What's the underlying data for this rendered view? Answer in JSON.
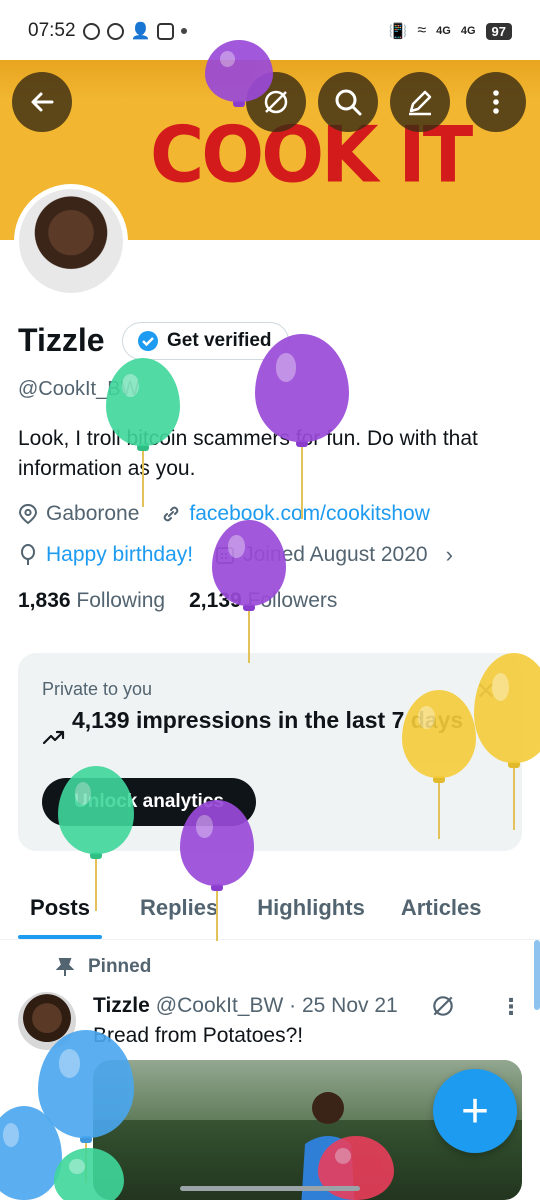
{
  "status": {
    "time": "07:52",
    "net1": "4G",
    "net2": "4G",
    "battery": "97"
  },
  "banner": {
    "logo_text": "COOK IT"
  },
  "profile": {
    "name": "Tizzle",
    "verify_label": "Get verified",
    "handle": "@CookIt_BW",
    "bio": "Look, I troll bitcoin scammers for fun. Do with that information as you.",
    "location": "Gaborone",
    "website": "facebook.com/cookitshow",
    "birthday": "Happy birthday!",
    "joined": "Joined August 2020",
    "following_count": "1,836",
    "following_label": "Following",
    "followers_count": "2,139",
    "followers_label": "Followers"
  },
  "analytics": {
    "label": "Private to you",
    "title": "4,139 impressions in the last 7 days",
    "button": "Unlock analytics"
  },
  "tabs": [
    {
      "label": "Posts"
    },
    {
      "label": "Replies"
    },
    {
      "label": "Highlights"
    },
    {
      "label": "Articles"
    }
  ],
  "post": {
    "pinned_label": "Pinned",
    "author": "Tizzle",
    "handle_date": "@CookIt_BW · 25 Nov 21",
    "text": "Bread from Potatoes?!"
  },
  "colors": {
    "accent": "#1d9bf0",
    "banner": "#f2b630",
    "logo": "#d31b1b"
  }
}
